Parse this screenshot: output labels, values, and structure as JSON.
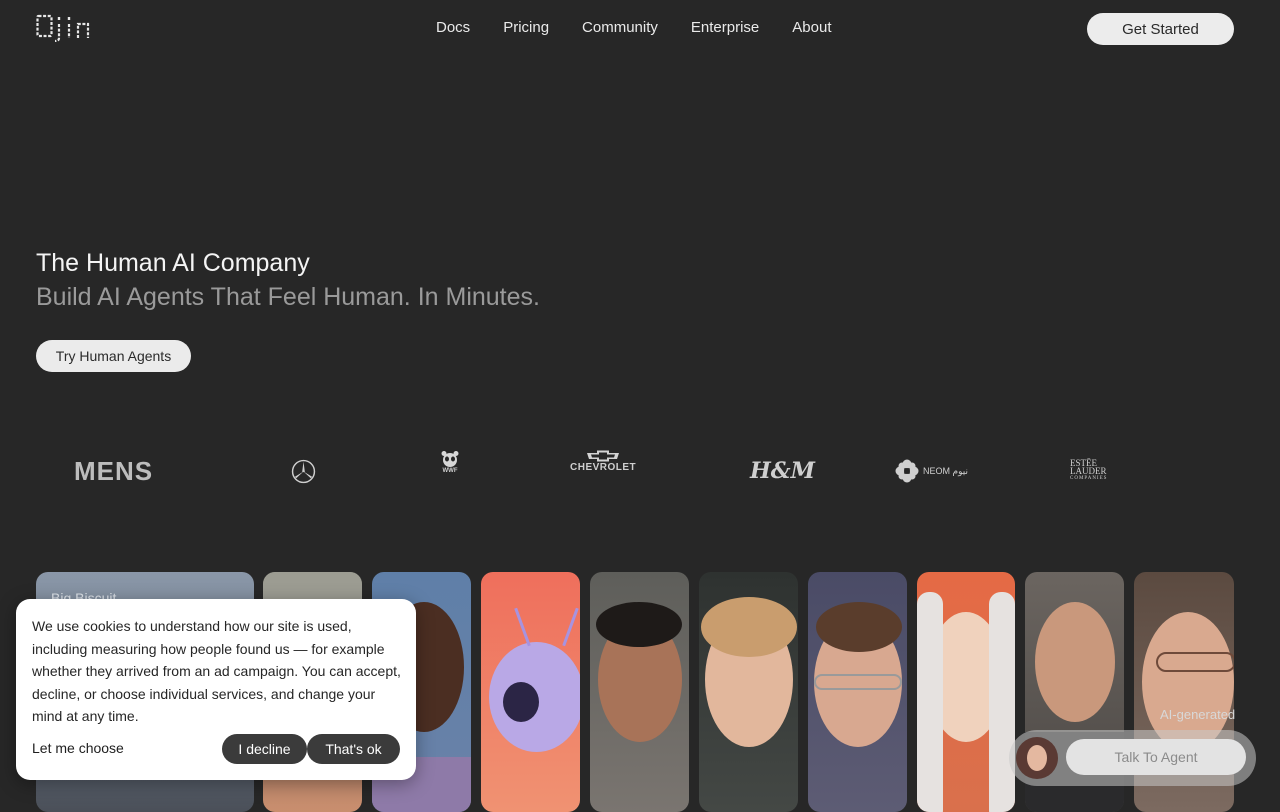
{
  "brand": {
    "logo_text": "Ojin"
  },
  "nav": {
    "items": [
      "Docs",
      "Pricing",
      "Community",
      "Enterprise",
      "About"
    ],
    "cta_label": "Get Started"
  },
  "hero": {
    "title": "The Human AI Company",
    "subtitle": "Build AI Agents That Feel Human. In Minutes.",
    "button_label": "Try Human Agents"
  },
  "logos": {
    "siemens": "MENS",
    "chevrolet": "CHEVROLET",
    "hm": "H&M",
    "neom": "NEOM نيوم",
    "wwf": "WWF",
    "estee_lines": [
      "ESTĒE",
      "LAUDER",
      "COMPANIES"
    ]
  },
  "cards": {
    "first_label": "Big Biscuit"
  },
  "cookie": {
    "text": "We use cookies to understand how our site is used, including measuring how people found us — for example whether they arrived from an ad campaign. You can accept, decline, or choose individual services, and change your mind at any time.",
    "choose_label": "Let me choose",
    "decline_label": "I decline",
    "accept_label": "That's ok"
  },
  "agent": {
    "ai_generated_label": "AI-generated",
    "talk_label": "Talk To Agent"
  },
  "colors": {
    "background": "#272727",
    "button_light": "#ececec",
    "cookie_button": "#3b3b3b"
  }
}
